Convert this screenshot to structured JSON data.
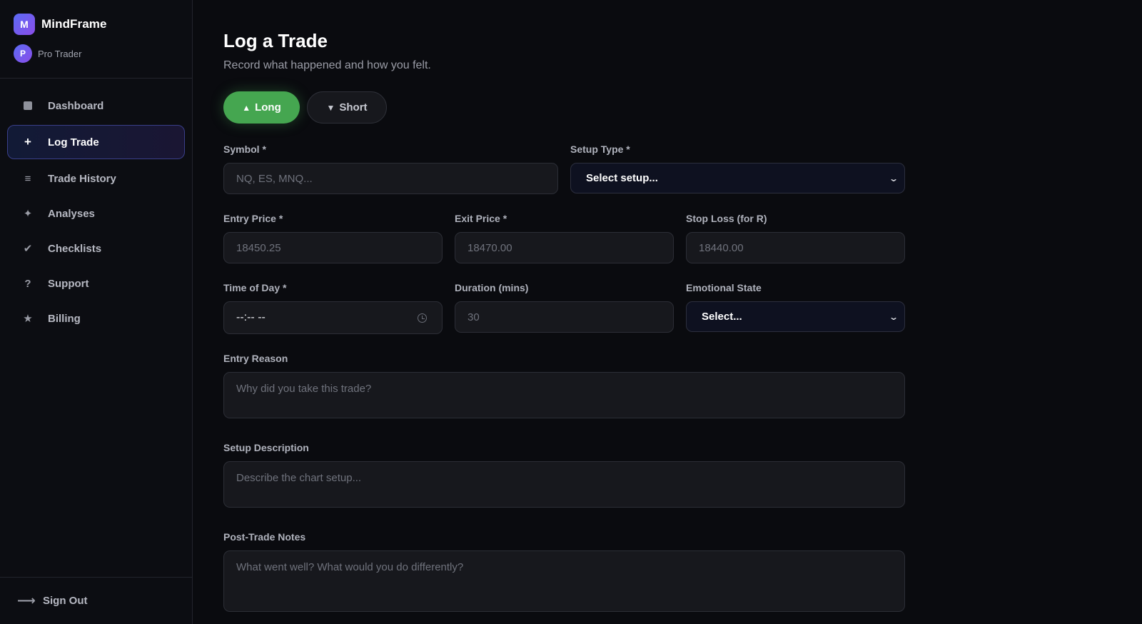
{
  "brand": {
    "initial": "M",
    "name": "MindFrame"
  },
  "user": {
    "initial": "P",
    "name": "Pro Trader"
  },
  "nav": {
    "items": [
      {
        "label": "Dashboard",
        "icon": "square-icon"
      },
      {
        "label": "Log Trade",
        "icon": "plus-icon",
        "active": true
      },
      {
        "label": "Trade History",
        "icon": "list-icon"
      },
      {
        "label": "Analyses",
        "icon": "sparkle-icon"
      },
      {
        "label": "Checklists",
        "icon": "check-icon"
      },
      {
        "label": "Support",
        "icon": "question-icon"
      },
      {
        "label": "Billing",
        "icon": "star-icon"
      }
    ],
    "sign_out": "Sign Out"
  },
  "page": {
    "title": "Log a Trade",
    "subtitle": "Record what happened and how you felt."
  },
  "direction": {
    "long_label": "Long",
    "short_label": "Short",
    "selected": "Long",
    "colors": {
      "long": "#45a650"
    }
  },
  "form": {
    "symbol": {
      "label": "Symbol *",
      "placeholder": "NQ, ES, MNQ..."
    },
    "setup_type": {
      "label": "Setup Type *",
      "value": "Select setup..."
    },
    "entry_price": {
      "label": "Entry Price *",
      "placeholder": "18450.25"
    },
    "exit_price": {
      "label": "Exit Price *",
      "placeholder": "18470.00"
    },
    "stop_loss": {
      "label": "Stop Loss (for R)",
      "placeholder": "18440.00"
    },
    "time_of_day": {
      "label": "Time of Day *",
      "value": "--:-- --"
    },
    "duration": {
      "label": "Duration (mins)",
      "placeholder": "30"
    },
    "emotional_state": {
      "label": "Emotional State",
      "value": "Select..."
    },
    "entry_reason": {
      "label": "Entry Reason",
      "placeholder": "Why did you take this trade?"
    },
    "setup_description": {
      "label": "Setup Description",
      "placeholder": "Describe the chart setup..."
    },
    "post_trade_notes": {
      "label": "Post-Trade Notes",
      "placeholder": "What went well? What would you do differently?"
    }
  }
}
